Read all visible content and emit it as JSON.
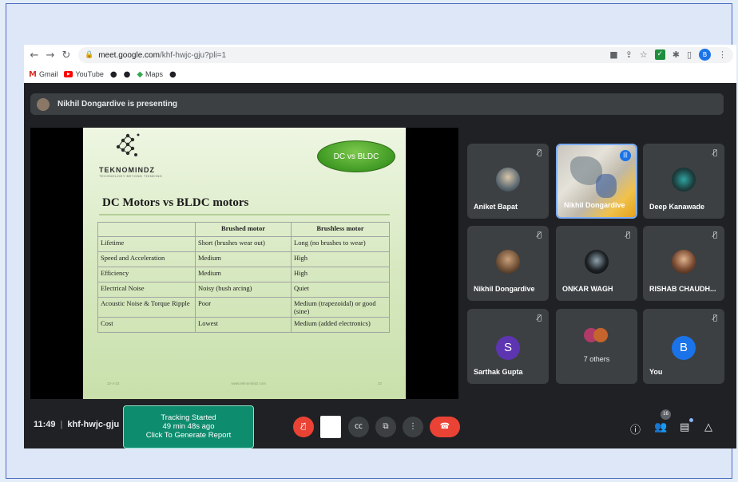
{
  "browser": {
    "url_host": "meet.google.com",
    "url_path": "/khf-hwjc-gju?pli=1",
    "profile_letter": "B",
    "bookmarks": [
      {
        "label": "Gmail",
        "icon": "gmail-icon"
      },
      {
        "label": "YouTube",
        "icon": "youtube-icon"
      },
      {
        "label": "",
        "icon": "github-icon"
      },
      {
        "label": "",
        "icon": "github-icon"
      },
      {
        "label": "Maps",
        "icon": "maps-icon"
      },
      {
        "label": "",
        "icon": "github-icon"
      }
    ]
  },
  "meet": {
    "presenting_text": "Nikhil Dongardive is presenting",
    "slide": {
      "logo_text": "TEKNOMINDZ",
      "logo_sub": "TECHNOLOGY BEYOND THINKING",
      "badge": "DC vs BLDC",
      "title": "DC Motors vs BLDC motors",
      "table_headers": [
        "",
        "Brushed motor",
        "Brushless motor"
      ],
      "table_rows": [
        [
          "Lifetime",
          "Short (brushes wear out)",
          "Long (no brushes to wear)"
        ],
        [
          "Speed and Acceleration",
          "Medium",
          "High"
        ],
        [
          "Efficiency",
          "Medium",
          "High"
        ],
        [
          "Electrical Noise",
          "Noisy (bush arcing)",
          "Quiet"
        ],
        [
          "Acoustic Noise & Torque Ripple",
          "Poor",
          "Medium (trapezoidal) or good (sine)"
        ],
        [
          "Cost",
          "Lowest",
          "Medium (added electronics)"
        ]
      ],
      "footer_left": "22-4-22",
      "footer_center": "www.teknomindz.com",
      "footer_right": "22"
    },
    "participants": [
      {
        "name": "Aniket Bapat",
        "type": "photo",
        "muted": true
      },
      {
        "name": "Nikhil Dongardive",
        "type": "camera",
        "muted": false,
        "speaking": true
      },
      {
        "name": "Deep Kanawade",
        "type": "photo",
        "muted": true
      },
      {
        "name": "Nikhil Dongardive",
        "type": "photo",
        "muted": true
      },
      {
        "name": "ONKAR WAGH",
        "type": "photo",
        "muted": true
      },
      {
        "name": "RISHAB CHAUDH...",
        "type": "photo",
        "muted": true
      },
      {
        "name": "Sarthak Gupta",
        "type": "letter",
        "letter": "S",
        "color": "#5e35b1",
        "muted": true
      },
      {
        "name": "7 others",
        "type": "others"
      },
      {
        "name": "You",
        "type": "letter",
        "letter": "B",
        "color": "#1a73e8",
        "muted": true
      }
    ],
    "toolbar": {
      "time": "11:49",
      "meeting_code": "khf-hwjc-gju",
      "tracking_line1": "Tracking Started",
      "tracking_line2": "49 min 48s ago",
      "tracking_line3": "Click To Generate Report",
      "people_count": "16"
    }
  },
  "colors": {
    "meet_bg": "#202124",
    "tile_bg": "#3c4043",
    "hangup_red": "#ea4335",
    "tracking_green": "#0e8c6e",
    "speaking_border": "#7cacf8"
  }
}
